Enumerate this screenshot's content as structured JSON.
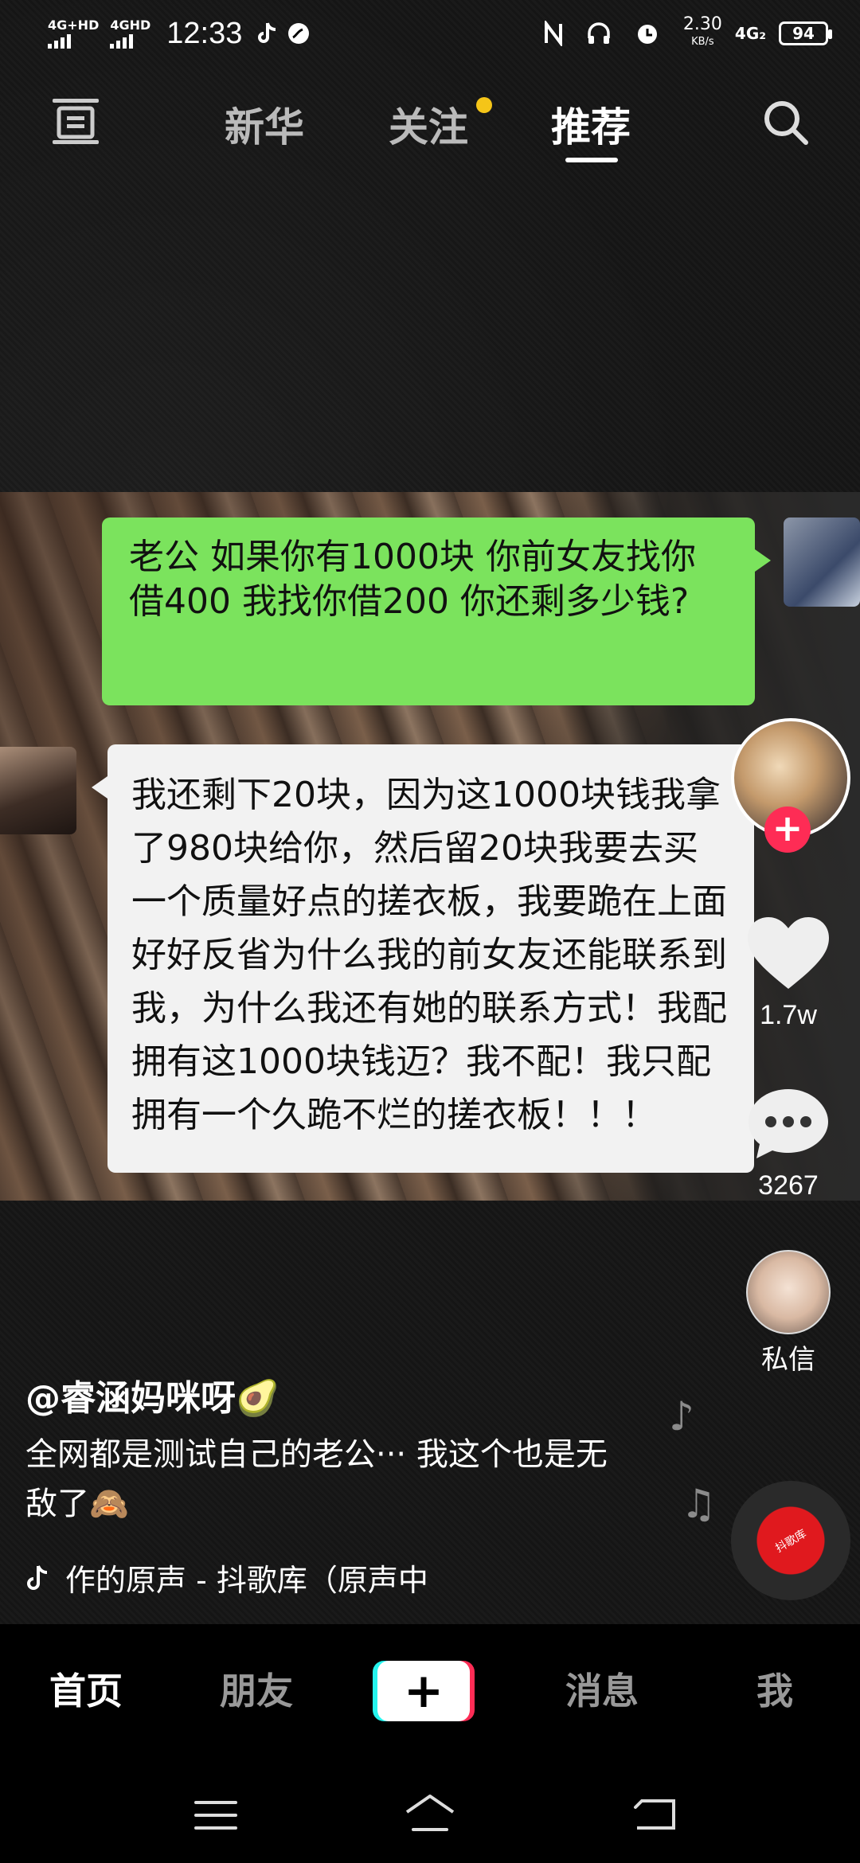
{
  "status_bar": {
    "network1": "4G+HD",
    "network2": "4GHD",
    "time": "12:33",
    "speed_value": "2.30",
    "speed_unit": "KB/s",
    "network3": "4G₂",
    "battery": "94"
  },
  "top_nav": {
    "tabs": [
      {
        "label": "新华"
      },
      {
        "label": "关注"
      },
      {
        "label": "推荐"
      }
    ],
    "active_tab": "推荐"
  },
  "chat": {
    "green_bubble": "老公 如果你有1000块 你前女友找你借400 我找你借200 你还剩多少钱?",
    "white_bubble": "我还剩下20块，因为这1000块钱我拿了980块给你，然后留20块我要去买一个质量好点的搓衣板，我要跪在上面好好反省为什么我的前女友还能联系到我，为什么我还有她的联系方式！我配拥有这1000块钱迈？我不配！我只配拥有一个久跪不烂的搓衣板！！！"
  },
  "right_rail": {
    "likes": "1.7w",
    "comments": "3267",
    "dm_label": "私信"
  },
  "post": {
    "author": "@睿涵妈咪呀🥑",
    "caption": "全网都是测试自己的老公··· 我这个也是无敌了🙈",
    "music": "作的原声 - 抖歌库（原声中"
  },
  "disc_label": "抖歌库",
  "bottom_tabs": {
    "home": "首页",
    "friends": "朋友",
    "messages": "消息",
    "me": "我"
  },
  "colors": {
    "accent_red": "#fe2c55",
    "accent_cyan": "#25f4ee",
    "bubble_green": "#7be35d",
    "dot_yellow": "#f5c518"
  }
}
